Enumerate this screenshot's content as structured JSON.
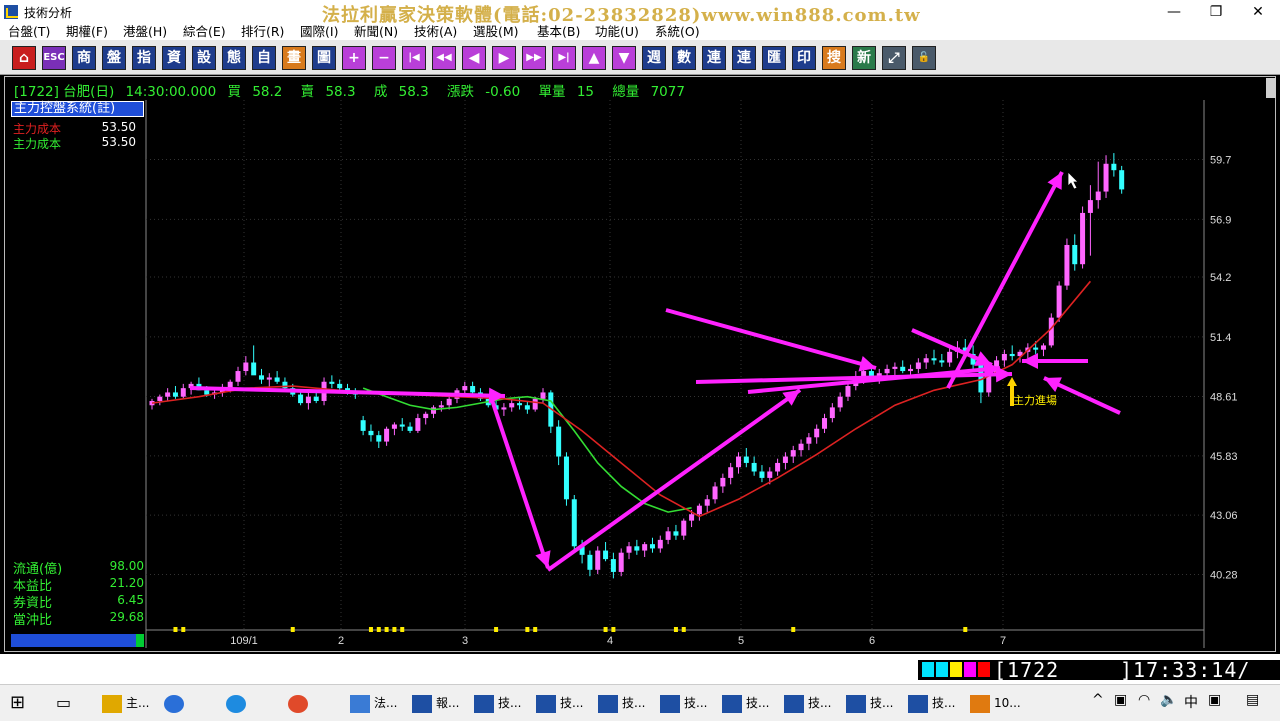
{
  "window": {
    "title": "技術分析",
    "banner": "法拉利贏家決策軟體(電話:02-23832828)www.win888.com.tw",
    "min_glyph": "—",
    "max_glyph": "❐",
    "close_glyph": "✕"
  },
  "menu": [
    "台盤(T)",
    "期權(F)",
    "港盤(H)",
    "綜合(E)",
    "排行(R)",
    "國際(I)",
    "新聞(N)",
    "技術(A)",
    "選股(M)",
    "基本(B)",
    "功能(U)",
    "系統(O)"
  ],
  "toolbar": [
    {
      "label": "⌂",
      "icon": "home-icon",
      "color": "red"
    },
    {
      "label": "ESC",
      "icon": "escape-icon",
      "color": "purple"
    },
    {
      "label": "商",
      "icon": "product-icon",
      "color": "blue"
    },
    {
      "label": "盤",
      "icon": "quote-icon",
      "color": "blue"
    },
    {
      "label": "指",
      "icon": "index-icon",
      "color": "blue"
    },
    {
      "label": "資",
      "icon": "info-icon",
      "color": "blue"
    },
    {
      "label": "設",
      "icon": "settings-icon",
      "color": "blue"
    },
    {
      "label": "態",
      "icon": "pattern-icon",
      "color": "blue"
    },
    {
      "label": "自",
      "icon": "custom-icon",
      "color": "blue"
    },
    {
      "label": "畫",
      "icon": "draw-icon",
      "color": "orange"
    },
    {
      "label": "圖",
      "icon": "chart-icon",
      "color": "blue"
    },
    {
      "label": "+",
      "icon": "zoom-in-icon",
      "color": "mag"
    },
    {
      "label": "−",
      "icon": "zoom-out-icon",
      "color": "mag"
    },
    {
      "label": "|◀",
      "icon": "first-icon",
      "color": "mag"
    },
    {
      "label": "◀◀",
      "icon": "rewind-icon",
      "color": "mag"
    },
    {
      "label": "◀",
      "icon": "prev-icon",
      "color": "mag"
    },
    {
      "label": "▶",
      "icon": "next-icon",
      "color": "mag"
    },
    {
      "label": "▶▶",
      "icon": "forward-icon",
      "color": "mag"
    },
    {
      "label": "▶|",
      "icon": "last-icon",
      "color": "mag"
    },
    {
      "label": "▲",
      "icon": "up-icon",
      "color": "mag"
    },
    {
      "label": "▼",
      "icon": "down-icon",
      "color": "mag"
    },
    {
      "label": "週",
      "icon": "week-icon",
      "color": "blue"
    },
    {
      "label": "數",
      "icon": "data-icon",
      "color": "blue"
    },
    {
      "label": "連",
      "icon": "link-icon",
      "color": "blue"
    },
    {
      "label": "連",
      "icon": "link2-icon",
      "color": "blue"
    },
    {
      "label": "匯",
      "icon": "export-icon",
      "color": "blue"
    },
    {
      "label": "印",
      "icon": "print-icon",
      "color": "blue"
    },
    {
      "label": "搜",
      "icon": "search-icon",
      "color": "orange"
    },
    {
      "label": "新",
      "icon": "new-icon",
      "color": "green"
    },
    {
      "label": "⤢",
      "icon": "window-icon",
      "color": "gray"
    },
    {
      "label": "🔓",
      "icon": "lock-icon",
      "color": "gray"
    }
  ],
  "quote": {
    "code_name": "[1722] 台肥(日)",
    "time": "14:30:00.000",
    "bid_label": "買",
    "bid": "58.2",
    "ask_label": "賣",
    "ask": "58.3",
    "deal_label": "成",
    "deal": "58.3",
    "change_label": "漲跌",
    "change": "-0.60",
    "vol_label": "單量",
    "vol": "15",
    "total_label": "總量",
    "total": "7077"
  },
  "indicator": {
    "title": "主力控盤系統(註)",
    "rows": [
      {
        "label": "主力成本",
        "value": "53.50",
        "color": "#e02020"
      },
      {
        "label": "主力成本",
        "value": "53.50",
        "color": "#33ee33"
      }
    ]
  },
  "stats": [
    {
      "label": "流通(億)",
      "value": "98.00"
    },
    {
      "label": "本益比",
      "value": "21.20"
    },
    {
      "label": "券資比",
      "value": "6.45"
    },
    {
      "label": "當沖比",
      "value": "29.68"
    }
  ],
  "status": {
    "code": "[1722",
    "time": "]17:33:14/"
  },
  "taskbar": {
    "items": [
      "主...",
      "法...",
      "報...",
      "技...",
      "技...",
      "技...",
      "技...",
      "技...",
      "技...",
      "技...",
      "技...",
      "10..."
    ],
    "ime": "中"
  },
  "chart_data": {
    "type": "candlestick",
    "yticks": [
      59.7,
      56.9,
      54.2,
      51.4,
      48.61,
      45.83,
      43.06,
      40.28
    ],
    "ylim": [
      38.0,
      61.4
    ],
    "xticks": [
      "109/1",
      "2",
      "3",
      "4",
      "5",
      "6",
      "7"
    ],
    "annotation": "主力進場",
    "candles": [
      [
        48.2,
        48.5,
        48.0,
        48.4
      ],
      [
        48.4,
        48.7,
        48.2,
        48.6
      ],
      [
        48.6,
        49.0,
        48.4,
        48.8
      ],
      [
        48.8,
        49.1,
        48.5,
        48.6
      ],
      [
        48.6,
        49.2,
        48.5,
        49.0
      ],
      [
        49.0,
        49.3,
        48.7,
        49.2
      ],
      [
        49.2,
        49.5,
        48.9,
        48.9
      ],
      [
        48.9,
        49.1,
        48.6,
        48.7
      ],
      [
        48.7,
        49.0,
        48.5,
        48.8
      ],
      [
        48.8,
        49.2,
        48.6,
        49.0
      ],
      [
        49.0,
        49.4,
        48.8,
        49.3
      ],
      [
        49.3,
        50.0,
        49.1,
        49.8
      ],
      [
        49.8,
        50.5,
        49.6,
        50.2
      ],
      [
        50.2,
        51.0,
        49.8,
        49.6
      ],
      [
        49.6,
        49.9,
        49.2,
        49.4
      ],
      [
        49.4,
        49.7,
        49.0,
        49.5
      ],
      [
        49.5,
        49.8,
        49.2,
        49.3
      ],
      [
        49.3,
        49.5,
        48.9,
        49.0
      ],
      [
        49.0,
        49.2,
        48.6,
        48.7
      ],
      [
        48.7,
        48.9,
        48.2,
        48.3
      ],
      [
        48.3,
        48.8,
        48.0,
        48.6
      ],
      [
        48.6,
        48.9,
        48.3,
        48.4
      ],
      [
        48.4,
        49.5,
        48.2,
        49.3
      ],
      [
        49.3,
        49.6,
        49.0,
        49.2
      ],
      [
        49.2,
        49.4,
        48.9,
        49.0
      ],
      [
        49.0,
        49.2,
        48.7,
        48.8
      ],
      [
        48.8,
        49.0,
        48.5,
        48.7
      ],
      [
        47.5,
        47.7,
        46.8,
        47.0
      ],
      [
        47.0,
        47.3,
        46.5,
        46.8
      ],
      [
        46.8,
        47.0,
        46.2,
        46.5
      ],
      [
        46.5,
        47.2,
        46.3,
        47.1
      ],
      [
        47.1,
        47.4,
        46.8,
        47.3
      ],
      [
        47.3,
        47.6,
        47.0,
        47.2
      ],
      [
        47.2,
        47.4,
        46.9,
        47.0
      ],
      [
        47.0,
        47.8,
        46.9,
        47.6
      ],
      [
        47.6,
        47.9,
        47.3,
        47.8
      ],
      [
        47.8,
        48.2,
        47.6,
        48.1
      ],
      [
        48.1,
        48.4,
        47.9,
        48.2
      ],
      [
        48.2,
        48.6,
        48.0,
        48.5
      ],
      [
        48.5,
        49.0,
        48.3,
        48.9
      ],
      [
        48.9,
        49.3,
        48.6,
        49.1
      ],
      [
        49.1,
        49.3,
        48.7,
        48.8
      ],
      [
        48.8,
        49.0,
        48.4,
        48.5
      ],
      [
        48.5,
        48.7,
        48.1,
        48.2
      ],
      [
        48.2,
        48.4,
        47.8,
        48.0
      ],
      [
        48.0,
        48.3,
        47.7,
        48.1
      ],
      [
        48.1,
        48.5,
        47.9,
        48.3
      ],
      [
        48.3,
        48.6,
        48.0,
        48.2
      ],
      [
        48.2,
        48.4,
        47.8,
        48.0
      ],
      [
        48.0,
        48.6,
        47.9,
        48.5
      ],
      [
        48.5,
        49.0,
        48.3,
        48.8
      ],
      [
        48.8,
        48.9,
        46.9,
        47.2
      ],
      [
        47.2,
        47.5,
        45.4,
        45.8
      ],
      [
        45.8,
        46.0,
        43.5,
        43.8
      ],
      [
        43.8,
        44.0,
        41.3,
        41.6
      ],
      [
        41.6,
        41.9,
        40.8,
        41.2
      ],
      [
        41.2,
        41.4,
        40.2,
        40.5
      ],
      [
        40.5,
        41.6,
        40.3,
        41.4
      ],
      [
        41.4,
        41.8,
        40.9,
        41.0
      ],
      [
        41.0,
        41.3,
        40.1,
        40.4
      ],
      [
        40.4,
        41.5,
        40.2,
        41.3
      ],
      [
        41.3,
        41.8,
        41.0,
        41.6
      ],
      [
        41.6,
        41.9,
        41.2,
        41.4
      ],
      [
        41.4,
        41.8,
        41.1,
        41.7
      ],
      [
        41.7,
        42.0,
        41.3,
        41.5
      ],
      [
        41.5,
        42.1,
        41.3,
        41.9
      ],
      [
        41.9,
        42.5,
        41.7,
        42.3
      ],
      [
        42.3,
        42.6,
        41.9,
        42.1
      ],
      [
        42.1,
        42.9,
        41.9,
        42.8
      ],
      [
        42.8,
        43.3,
        42.5,
        43.1
      ],
      [
        43.1,
        43.6,
        42.8,
        43.5
      ],
      [
        43.5,
        44.0,
        43.2,
        43.8
      ],
      [
        43.8,
        44.6,
        43.6,
        44.4
      ],
      [
        44.4,
        45.0,
        44.1,
        44.8
      ],
      [
        44.8,
        45.5,
        44.5,
        45.3
      ],
      [
        45.3,
        46.0,
        45.0,
        45.8
      ],
      [
        45.8,
        46.2,
        45.3,
        45.5
      ],
      [
        45.5,
        45.8,
        44.9,
        45.1
      ],
      [
        45.1,
        45.4,
        44.6,
        44.8
      ],
      [
        44.8,
        45.3,
        44.5,
        45.1
      ],
      [
        45.1,
        45.7,
        44.9,
        45.5
      ],
      [
        45.5,
        46.0,
        45.2,
        45.8
      ],
      [
        45.8,
        46.3,
        45.5,
        46.1
      ],
      [
        46.1,
        46.6,
        45.8,
        46.4
      ],
      [
        46.4,
        46.9,
        46.1,
        46.7
      ],
      [
        46.7,
        47.3,
        46.4,
        47.1
      ],
      [
        47.1,
        47.8,
        46.9,
        47.6
      ],
      [
        47.6,
        48.3,
        47.4,
        48.1
      ],
      [
        48.1,
        48.8,
        47.9,
        48.6
      ],
      [
        48.6,
        49.3,
        48.4,
        49.1
      ],
      [
        49.1,
        49.8,
        48.9,
        49.5
      ],
      [
        49.5,
        50.3,
        49.2,
        49.8
      ],
      [
        49.8,
        50.0,
        49.3,
        49.5
      ],
      [
        49.5,
        49.9,
        49.2,
        49.7
      ],
      [
        49.7,
        50.1,
        49.4,
        49.9
      ],
      [
        49.9,
        50.2,
        49.6,
        50.0
      ],
      [
        50.0,
        50.3,
        49.7,
        49.8
      ],
      [
        49.8,
        50.1,
        49.5,
        49.9
      ],
      [
        49.9,
        50.4,
        49.7,
        50.2
      ],
      [
        50.2,
        50.6,
        49.9,
        50.4
      ],
      [
        50.4,
        50.8,
        50.1,
        50.3
      ],
      [
        50.3,
        50.6,
        50.0,
        50.2
      ],
      [
        50.2,
        50.9,
        50.0,
        50.7
      ],
      [
        50.7,
        51.2,
        50.4,
        50.9
      ],
      [
        50.9,
        51.3,
        50.5,
        50.6
      ],
      [
        50.6,
        51.0,
        49.8,
        50.1
      ],
      [
        50.1,
        50.3,
        48.3,
        48.8
      ],
      [
        48.8,
        49.9,
        48.6,
        49.7
      ],
      [
        49.7,
        50.5,
        49.5,
        50.3
      ],
      [
        50.3,
        50.8,
        50.0,
        50.6
      ],
      [
        50.6,
        51.0,
        50.3,
        50.5
      ],
      [
        50.5,
        50.8,
        50.2,
        50.7
      ],
      [
        50.7,
        51.1,
        50.4,
        50.9
      ],
      [
        50.9,
        51.2,
        50.6,
        50.8
      ],
      [
        50.8,
        51.1,
        50.5,
        51.0
      ],
      [
        51.0,
        52.5,
        50.9,
        52.3
      ],
      [
        52.3,
        54.0,
        52.1,
        53.8
      ],
      [
        53.8,
        56.0,
        53.6,
        55.7
      ],
      [
        55.7,
        56.2,
        54.5,
        54.8
      ],
      [
        54.8,
        57.5,
        54.6,
        57.2
      ],
      [
        57.2,
        58.5,
        55.2,
        57.8
      ],
      [
        57.8,
        59.6,
        57.4,
        58.2
      ],
      [
        58.2,
        59.9,
        57.9,
        59.5
      ],
      [
        59.5,
        60.0,
        58.9,
        59.2
      ],
      [
        59.2,
        59.4,
        58.1,
        58.3
      ]
    ],
    "red_line_x": [
      0,
      6,
      12,
      18,
      24,
      27,
      33,
      39,
      45,
      50,
      55,
      60,
      65,
      70,
      75,
      80,
      85,
      90,
      95,
      100,
      106,
      110,
      115,
      120
    ],
    "red_line_y": [
      48.3,
      48.6,
      49.0,
      49.1,
      48.9,
      48.8,
      48.7,
      48.6,
      48.5,
      48.3,
      47.0,
      45.5,
      44.0,
      43.0,
      43.8,
      44.8,
      45.9,
      47.1,
      48.2,
      48.9,
      49.4,
      50.1,
      51.8,
      54.0
    ],
    "green_line_x": [
      27,
      30,
      33,
      36,
      39,
      42,
      45,
      48,
      51,
      54,
      57,
      60,
      63,
      66,
      69
    ],
    "green_line_y": [
      49.0,
      48.6,
      48.2,
      48.0,
      48.1,
      48.3,
      48.5,
      48.6,
      48.4,
      47.0,
      45.5,
      44.4,
      43.6,
      43.2,
      43.4
    ],
    "volume_marks_x": [
      3,
      4,
      18,
      28,
      29,
      30,
      31,
      32,
      44,
      48,
      49,
      58,
      59,
      67,
      68,
      82,
      104
    ]
  }
}
